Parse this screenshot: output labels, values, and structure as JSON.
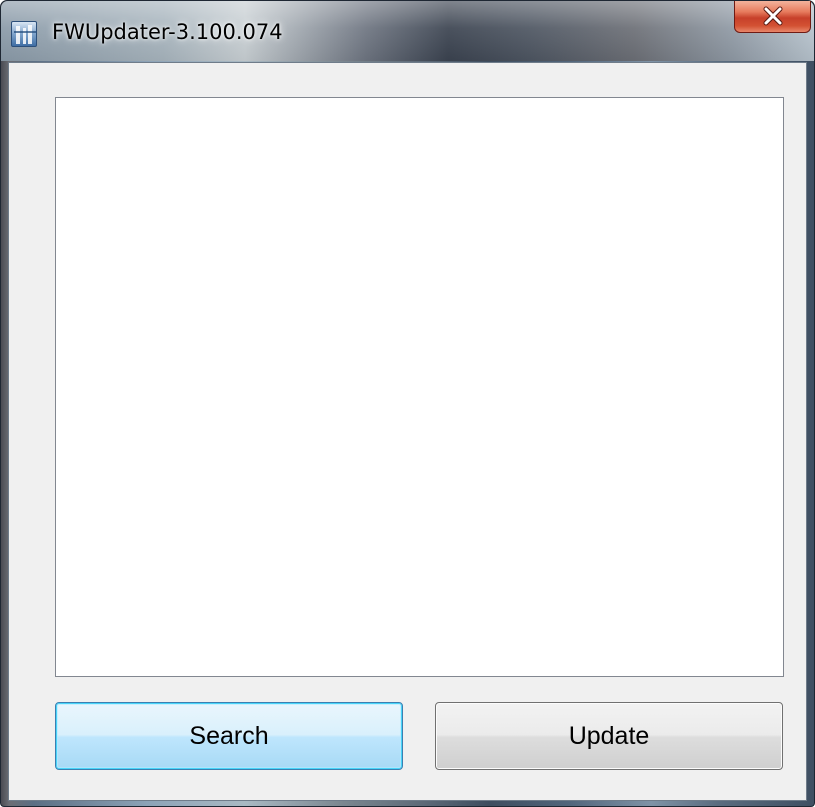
{
  "window": {
    "title": "FWUpdater-3.100.074",
    "icon": "app-icon"
  },
  "titlebar": {
    "close_icon": "close-icon"
  },
  "listbox": {
    "items": []
  },
  "buttons": {
    "search_label": "Search",
    "update_label": "Update"
  },
  "colors": {
    "client_background": "#f0f0f0",
    "close_button": "#c7402a",
    "focused_button_border": "#3c7fb1"
  }
}
